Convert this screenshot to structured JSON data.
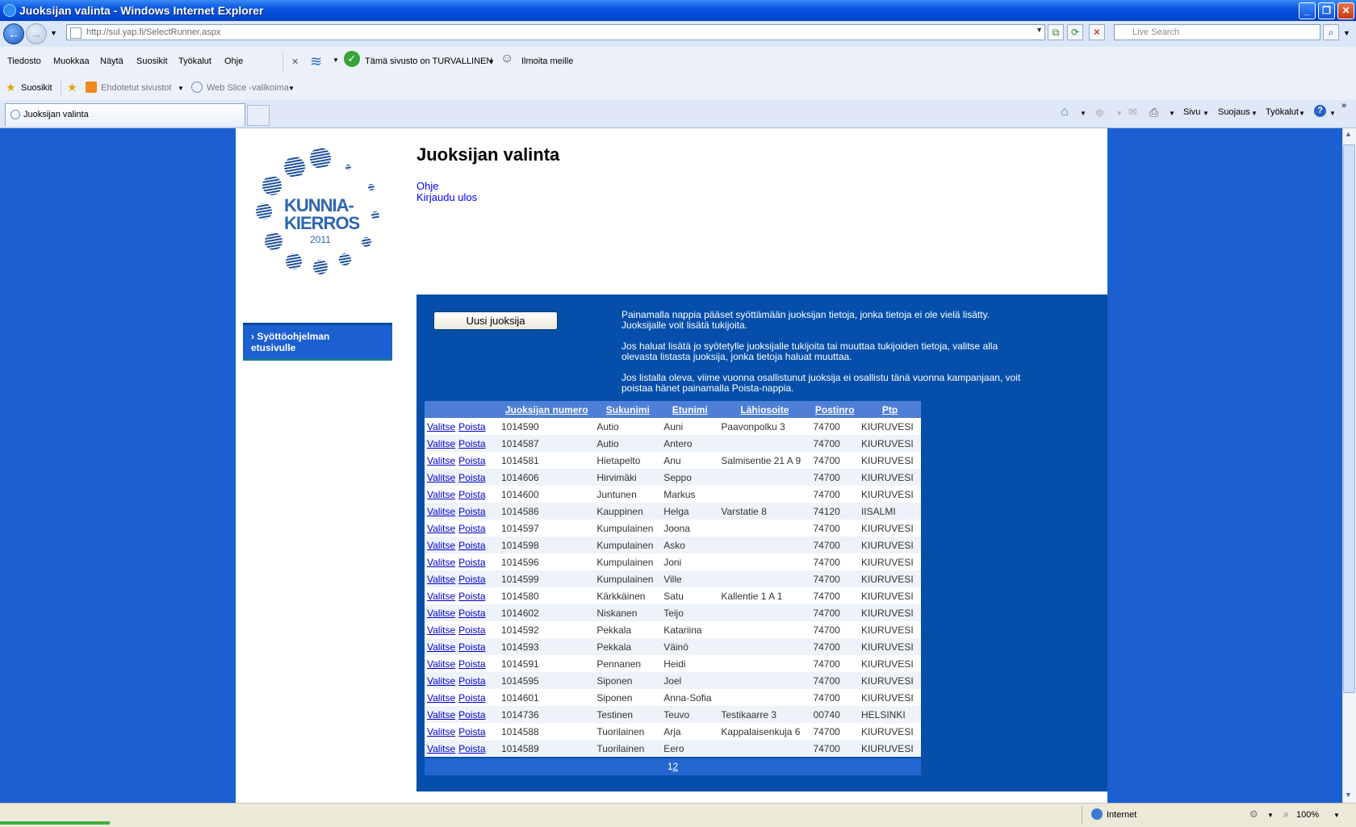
{
  "window": {
    "title": "Juoksijan valinta - Windows Internet Explorer"
  },
  "address": {
    "url": "http://sul.yap.fi/SelectRunner.aspx",
    "search_placeholder": "Live Search"
  },
  "menu": [
    "Tiedosto",
    "Muokkaa",
    "Näytä",
    "Suosikit",
    "Työkalut",
    "Ohje"
  ],
  "toolbar": {
    "secure_text": "Tämä sivusto on TURVALLINEN",
    "report_text": "Ilmoita meille"
  },
  "favorites": {
    "favorites_label": "Suosikit",
    "suggested": "Ehdotetut sivustot",
    "webslice": "Web Slice -valikoima"
  },
  "tab": {
    "label": "Juoksijan valinta"
  },
  "commandbar": {
    "page": "Sivu",
    "safety": "Suojaus",
    "tools": "Työkalut"
  },
  "page": {
    "heading": "Juoksijan valinta",
    "links": {
      "help": "Ohje",
      "logout": "Kirjaudu ulos"
    },
    "logo": {
      "line1": "KUNNIA-",
      "line2": "KIERROS",
      "year": "2011"
    },
    "side_button": "› Syöttöohjelman etusivulle",
    "new_runner_button": "Uusi juoksija",
    "info": [
      "Painamalla nappia pääset syöttämään juoksijan tietoja, jonka tietoja ei ole vielä lisätty. Juoksijalle voit lisätä tukijoita.",
      "Jos haluat lisätä jo syötetylle juoksijalle tukijoita tai muuttaa tukijoiden tietoja, valitse alla olevasta listasta juoksija, jonka tietoja haluat muuttaa.",
      "Jos listalla oleva, viime vuonna osallistunut juoksija ei osallistu tänä vuonna kampanjaan, voit poistaa hänet painamalla Poista-nappia."
    ],
    "table": {
      "select_label": "Valitse",
      "delete_label": "Poista",
      "headers": [
        "Juoksijan numero",
        "Sukunimi",
        "Etunimi",
        "Lähiosoite",
        "Postinro",
        "Ptp"
      ],
      "rows": [
        [
          "1014590",
          "Autio",
          "Auni",
          "Paavonpolku 3",
          "74700",
          "KIURUVESI"
        ],
        [
          "1014587",
          "Autio",
          "Antero",
          "",
          "74700",
          "KIURUVESI"
        ],
        [
          "1014581",
          "Hietapelto",
          "Anu",
          "Salmisentie 21 A 9",
          "74700",
          "KIURUVESI"
        ],
        [
          "1014606",
          "Hirvimäki",
          "Seppo",
          "",
          "74700",
          "KIURUVESI"
        ],
        [
          "1014600",
          "Juntunen",
          "Markus",
          "",
          "74700",
          "KIURUVESI"
        ],
        [
          "1014586",
          "Kauppinen",
          "Helga",
          "Varstatie 8",
          "74120",
          "IISALMI"
        ],
        [
          "1014597",
          "Kumpulainen",
          "Joona",
          "",
          "74700",
          "KIURUVESI"
        ],
        [
          "1014598",
          "Kumpulainen",
          "Asko",
          "",
          "74700",
          "KIURUVESI"
        ],
        [
          "1014596",
          "Kumpulainen",
          "Joni",
          "",
          "74700",
          "KIURUVESI"
        ],
        [
          "1014599",
          "Kumpulainen",
          "Ville",
          "",
          "74700",
          "KIURUVESI"
        ],
        [
          "1014580",
          "Kärkkäinen",
          "Satu",
          "Kallentie 1 A 1",
          "74700",
          "KIURUVESI"
        ],
        [
          "1014602",
          "Niskanen",
          "Teijo",
          "",
          "74700",
          "KIURUVESI"
        ],
        [
          "1014592",
          "Pekkala",
          "Katariina",
          "",
          "74700",
          "KIURUVESI"
        ],
        [
          "1014593",
          "Pekkala",
          "Väinö",
          "",
          "74700",
          "KIURUVESI"
        ],
        [
          "1014591",
          "Pennanen",
          "Heidi",
          "",
          "74700",
          "KIURUVESI"
        ],
        [
          "1014595",
          "Siponen",
          "Joel",
          "",
          "74700",
          "KIURUVESI"
        ],
        [
          "1014601",
          "Siponen",
          "Anna-Sofia",
          "",
          "74700",
          "KIURUVESI"
        ],
        [
          "1014736",
          "Testinen",
          "Teuvo",
          "Testikaarre 3",
          "00740",
          "HELSINKI"
        ],
        [
          "1014588",
          "Tuorilainen",
          "Arja",
          "Kappalaisenkuja 6",
          "74700",
          "KIURUVESI"
        ],
        [
          "1014589",
          "Tuorilainen",
          "Eero",
          "",
          "74700",
          "KIURUVESI"
        ]
      ]
    },
    "pager": {
      "current": "1",
      "next": "2"
    }
  },
  "status": {
    "zone": "Internet",
    "zoom": "100%"
  }
}
